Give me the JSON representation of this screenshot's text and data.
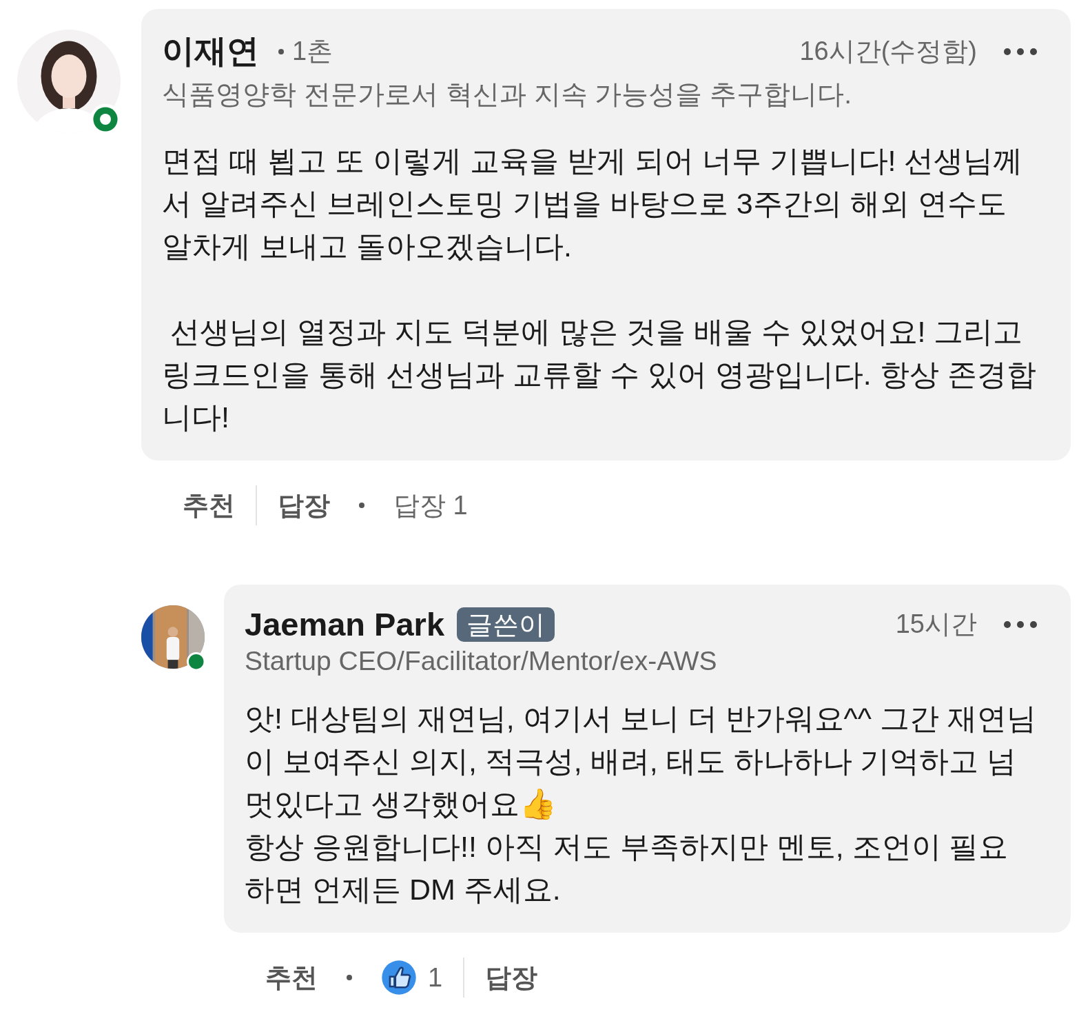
{
  "comments": [
    {
      "author": "이재연",
      "degree": "1촌",
      "headline": "식품영양학 전문가로서 혁신과 지속 가능성을 추구합니다.",
      "time": "16시간(수정함)",
      "paragraphs": [
        "면접 때 뵙고 또 이렇게 교육을 받게 되어 너무 기쁩니다! 선생님께서 알려주신 브레인스토밍 기법을 바탕으로 3주간의 해외 연수도 알차게 보내고 돌아오겠습니다.",
        " 선생님의 열정과 지도 덕분에 많은 것을 배울 수 있었어요! 그리고 링크드인을 통해 선생님과 교류할 수 있어 영광입니다. 항상 존경합니다!"
      ],
      "actions": [
        {
          "kind": "text",
          "label": "추천"
        },
        {
          "kind": "divider"
        },
        {
          "kind": "text",
          "label": "답장"
        },
        {
          "kind": "dot"
        },
        {
          "kind": "count",
          "label": "답장 1"
        }
      ]
    },
    {
      "author": "Jaeman Park",
      "badge": "글쓴이",
      "headline": "Startup CEO/Facilitator/Mentor/ex-AWS",
      "time": "15시간",
      "paragraphs": [
        "앗! 대상팀의 재연님, 여기서 보니 더 반가워요^^ 그간 재연님이 보여주신 의지, 적극성, 배려, 태도 하나하나 기억하고 넘 멋있다고 생각했어요👍",
        "항상 응원합니다!! 아직 저도 부족하지만 멘토, 조언이 필요하면 언제든 DM 주세요."
      ],
      "actions": [
        {
          "kind": "text",
          "label": "추천"
        },
        {
          "kind": "dot"
        },
        {
          "kind": "reaction",
          "label": "1"
        },
        {
          "kind": "divider"
        },
        {
          "kind": "text",
          "label": "답장"
        }
      ]
    }
  ]
}
